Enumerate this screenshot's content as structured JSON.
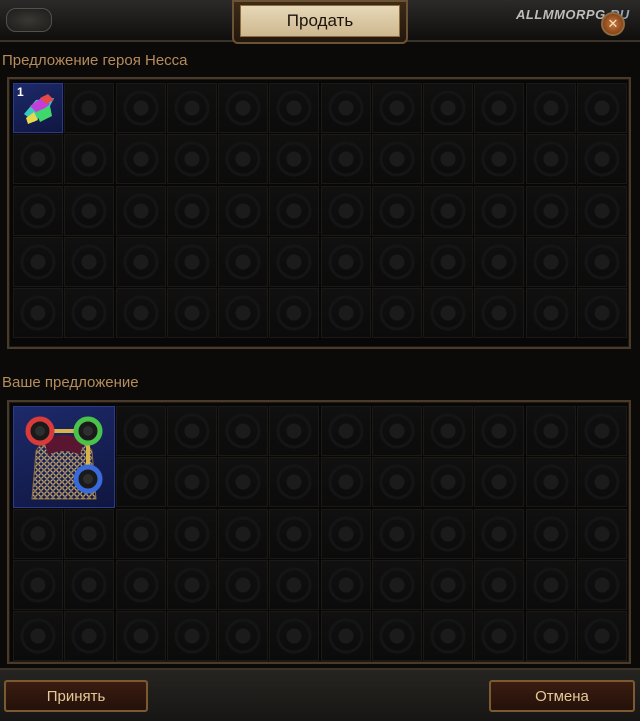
{
  "header": {
    "sell_title": "Продать",
    "watermark_main": "ALLMMORPG",
    "watermark_suffix": ".RU",
    "close_icon": "close-icon"
  },
  "vendor_offer": {
    "label": "Предложение героя Несса",
    "columns": 12,
    "rows": 5,
    "items": [
      {
        "name": "jewel-item",
        "icon": "rainbow-gem-icon",
        "count": "1"
      }
    ]
  },
  "your_offer": {
    "label": "Ваше предложение",
    "columns": 12,
    "rows": 5,
    "items": [
      {
        "name": "chainmail-armour-item",
        "icon": "linked-sockets-armour-icon"
      }
    ]
  },
  "footer": {
    "accept_label": "Принять",
    "cancel_label": "Отмена"
  },
  "colors": {
    "label_color": "#b58c5b",
    "button_text": "#e5c999",
    "item_bg": "#1d2a6a"
  }
}
